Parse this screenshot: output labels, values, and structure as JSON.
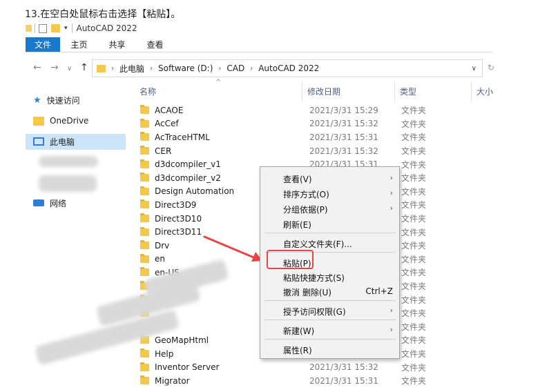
{
  "instruction": "13.在空白处鼠标右击选择【粘贴】。",
  "window": {
    "title": "AutoCAD 2022"
  },
  "ribbon": {
    "tabs": [
      "文件",
      "主页",
      "共享",
      "查看"
    ]
  },
  "address": {
    "segments": [
      "此电脑",
      "Software (D:)",
      "CAD",
      "AutoCAD 2022"
    ]
  },
  "columns": {
    "name": "名称",
    "date": "修改日期",
    "type": "类型",
    "size": "大小"
  },
  "nav": {
    "quick": "快速访问",
    "onedrive": "OneDrive",
    "pc": "此电脑",
    "network": "网络"
  },
  "files": [
    {
      "name": "ACAOE",
      "date": "2021/3/31 15:29",
      "type": "文件夹"
    },
    {
      "name": "AcCef",
      "date": "2021/3/31 15:32",
      "type": "文件夹"
    },
    {
      "name": "AcTraceHTML",
      "date": "2021/3/31 15:31",
      "type": "文件夹"
    },
    {
      "name": "CER",
      "date": "2021/3/31 15:32",
      "type": "文件夹"
    },
    {
      "name": "d3dcompiler_v1",
      "date": "2021/3/31 15:31",
      "type": "文件夹"
    },
    {
      "name": "d3dcompiler_v2",
      "date": "",
      "type": "文件夹"
    },
    {
      "name": "Design Automation",
      "date": "",
      "type": "文件夹"
    },
    {
      "name": "Direct3D9",
      "date": "",
      "type": "文件夹"
    },
    {
      "name": "Direct3D10",
      "date": "",
      "type": "文件夹"
    },
    {
      "name": "Direct3D11",
      "date": "",
      "type": "文件夹"
    },
    {
      "name": "Drv",
      "date": "",
      "type": "文件夹"
    },
    {
      "name": "en",
      "date": "",
      "type": "文件夹"
    },
    {
      "name": "en-US",
      "date": "",
      "type": "文件夹"
    },
    {
      "name": "",
      "date": "",
      "type": "文件夹"
    },
    {
      "name": "",
      "date": "",
      "type": "文件夹"
    },
    {
      "name": "",
      "date": "",
      "type": "文件夹"
    },
    {
      "name": "",
      "date": "",
      "type": "文件夹"
    },
    {
      "name": "GeoMapHtml",
      "date": "",
      "type": "文件夹"
    },
    {
      "name": "Help",
      "date": "",
      "type": "文件夹"
    },
    {
      "name": "Inventor Server",
      "date": "2021/3/31 15:32",
      "type": "文件夹"
    },
    {
      "name": "Migrator",
      "date": "2021/3/31 15:31",
      "type": "文件夹"
    }
  ],
  "menu": {
    "view": "查看(V)",
    "sort": "排序方式(O)",
    "group": "分组依据(P)",
    "refresh": "刷新(E)",
    "customize": "自定义文件夹(F)...",
    "paste": "粘贴(P)",
    "paste_shortcut": "粘贴快捷方式(S)",
    "undo": "撤消 删除(U)",
    "undo_key": "Ctrl+Z",
    "access": "授予访问权限(G)",
    "new": "新建(W)",
    "properties": "属性(R)"
  },
  "colors": {
    "accent": "#1979ca",
    "folder": "#f3c94b",
    "highlight": "#e64545"
  }
}
